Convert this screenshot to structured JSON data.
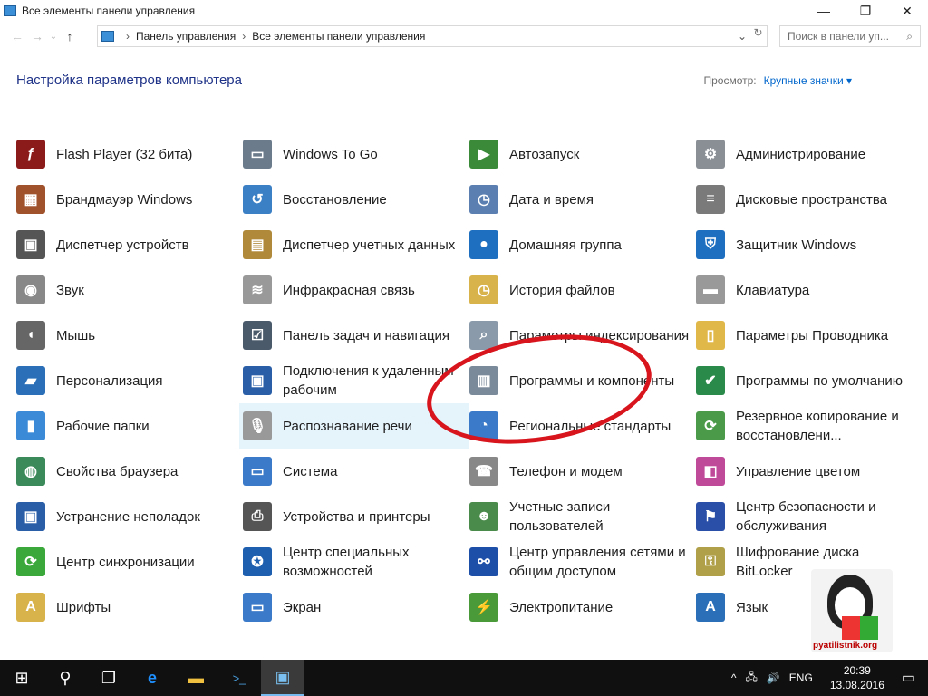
{
  "window": {
    "title": "Все элементы панели управления",
    "minimize": "—",
    "maximize": "❐",
    "close": "✕"
  },
  "nav": {
    "back": "←",
    "forward": "→",
    "recent": "⌄",
    "up": "↑",
    "breadcrumb": [
      "Панель управления",
      "Все элементы панели управления"
    ],
    "dropdown": "⌄",
    "refresh": "↻",
    "search_placeholder": "Поиск в панели уп...",
    "search_icon": "⌕"
  },
  "header": {
    "title": "Настройка параметров компьютера",
    "view_label": "Просмотр:",
    "view_value": "Крупные значки ▾"
  },
  "items": [
    {
      "label": "Flash Player (32 бита)",
      "color": "#8b1a1a",
      "g": "ƒ"
    },
    {
      "label": "Windows To Go",
      "color": "#6b7b8c",
      "g": "▭"
    },
    {
      "label": "Автозапуск",
      "color": "#3a8a3a",
      "g": "▶"
    },
    {
      "label": "Администрирование",
      "color": "#8a8f96",
      "g": "⚙"
    },
    {
      "label": "Брандмауэр Windows",
      "color": "#a0522d",
      "g": "▦"
    },
    {
      "label": "Восстановление",
      "color": "#3b7fc4",
      "g": "↺"
    },
    {
      "label": "Дата и время",
      "color": "#5a7fb0",
      "g": "◷"
    },
    {
      "label": "Дисковые пространства",
      "color": "#7a7a7a",
      "g": "≡"
    },
    {
      "label": "Диспетчер устройств",
      "color": "#555",
      "g": "▣"
    },
    {
      "label": "Диспетчер учетных данных",
      "color": "#b08a3a",
      "g": "▤"
    },
    {
      "label": "Домашняя группа",
      "color": "#1e6fc0",
      "g": "●"
    },
    {
      "label": "Защитник Windows",
      "color": "#1e6fc0",
      "g": "⛨"
    },
    {
      "label": "Звук",
      "color": "#888",
      "g": "◉"
    },
    {
      "label": "Инфракрасная связь",
      "color": "#999",
      "g": "≋"
    },
    {
      "label": "История файлов",
      "color": "#d8b24a",
      "g": "◷"
    },
    {
      "label": "Клавиатура",
      "color": "#999",
      "g": "▬"
    },
    {
      "label": "Мышь",
      "color": "#666",
      "g": "◖"
    },
    {
      "label": "Панель задач и навигация",
      "color": "#4a5a6a",
      "g": "☑"
    },
    {
      "label": "Параметры индексирования",
      "color": "#8a9aaa",
      "g": "⌕"
    },
    {
      "label": "Параметры Проводника",
      "color": "#e0b84a",
      "g": "▯"
    },
    {
      "label": "Персонализация",
      "color": "#2a6fb8",
      "g": "▰"
    },
    {
      "label": "Подключения к удаленным рабочим",
      "color": "#2a5fa8",
      "g": "▣"
    },
    {
      "label": "Программы и компоненты",
      "color": "#7a8a9a",
      "g": "▥"
    },
    {
      "label": "Программы по умолчанию",
      "color": "#2a8a4a",
      "g": "✔"
    },
    {
      "label": "Рабочие папки",
      "color": "#3a8ad8",
      "g": "▮"
    },
    {
      "label": "Распознавание речи",
      "color": "#999",
      "g": "🎙"
    },
    {
      "label": "Региональные стандарты",
      "color": "#3a7ac8",
      "g": "◔"
    },
    {
      "label": "Резервное копирование и восстановлени...",
      "color": "#4a9a4a",
      "g": "⟳"
    },
    {
      "label": "Свойства браузера",
      "color": "#3a8a5a",
      "g": "◍"
    },
    {
      "label": "Система",
      "color": "#3a7ac8",
      "g": "▭"
    },
    {
      "label": "Телефон и модем",
      "color": "#888",
      "g": "☎"
    },
    {
      "label": "Управление цветом",
      "color": "#c04a9a",
      "g": "◧"
    },
    {
      "label": "Устранение неполадок",
      "color": "#2a5fa8",
      "g": "▣"
    },
    {
      "label": "Устройства и принтеры",
      "color": "#555",
      "g": "⎙"
    },
    {
      "label": "Учетные записи пользователей",
      "color": "#4a8a4a",
      "g": "☻"
    },
    {
      "label": "Центр безопасности и обслуживания",
      "color": "#2a4fa8",
      "g": "⚑"
    },
    {
      "label": "Центр синхронизации",
      "color": "#3aa83a",
      "g": "⟳"
    },
    {
      "label": "Центр специальных возможностей",
      "color": "#1e5fb0",
      "g": "✪"
    },
    {
      "label": "Центр управления сетями и общим доступом",
      "color": "#1e4fa8",
      "g": "⚯"
    },
    {
      "label": "Шифрование диска BitLocker",
      "color": "#b0a04a",
      "g": "⚿"
    },
    {
      "label": "Шрифты",
      "color": "#d8b24a",
      "g": "A"
    },
    {
      "label": "Экран",
      "color": "#3a7ac8",
      "g": "▭"
    },
    {
      "label": "Электропитание",
      "color": "#4a9a3a",
      "g": "⚡"
    },
    {
      "label": "Язык",
      "color": "#2a6fb8",
      "g": "A"
    }
  ],
  "watermark": "pyatilistnik.org",
  "taskbar": {
    "start": "⊞",
    "search": "⚲",
    "taskview": "❐",
    "edge": "e",
    "explorer": "▬",
    "powershell": ">_",
    "controlpanel": "▣",
    "tray_up": "^",
    "network": "🖧",
    "volume": "🔊",
    "lang": "ENG",
    "time": "20:39",
    "date": "13.08.2016",
    "notifications": "▭"
  }
}
